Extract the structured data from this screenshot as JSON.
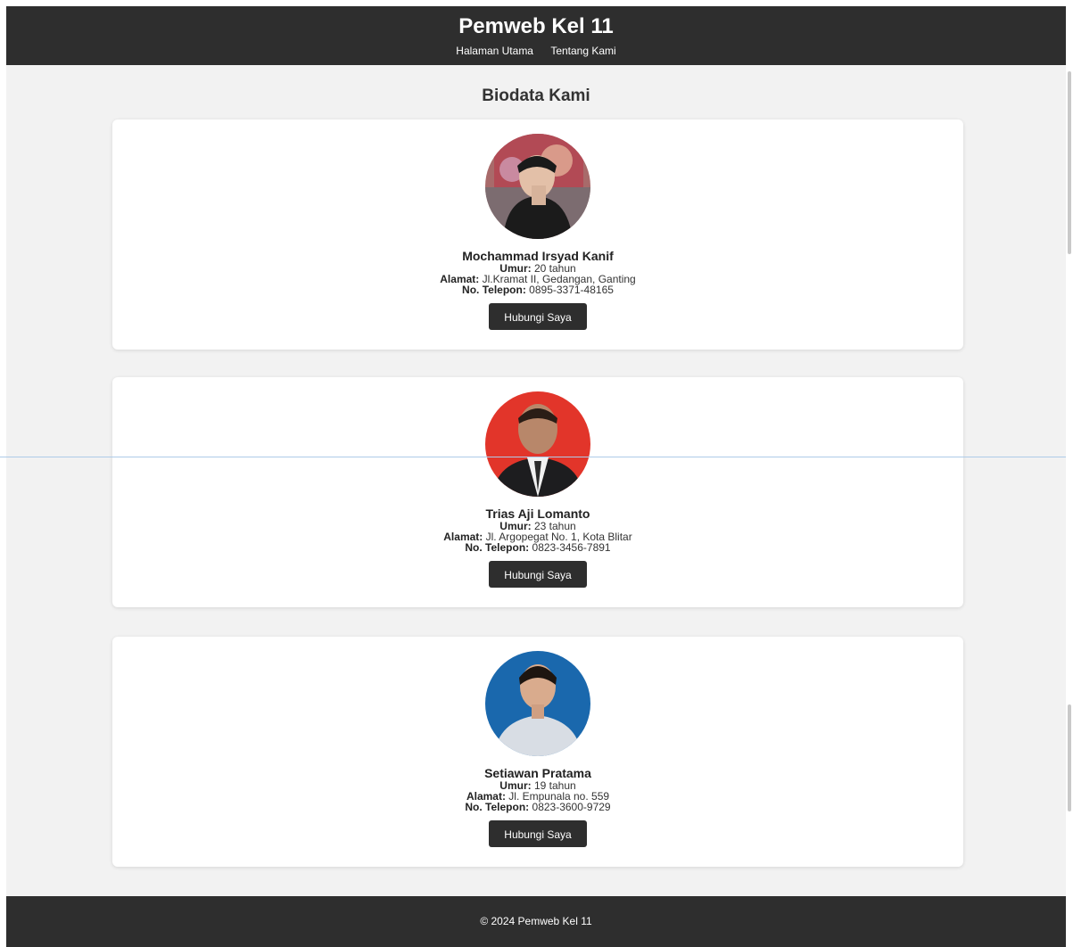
{
  "header": {
    "title": "Pemweb Kel 11",
    "nav": [
      "Halaman Utama",
      "Tentang Kami"
    ]
  },
  "section_title": "Biodata Kami",
  "labels": {
    "age": "Umur:",
    "address": "Alamat:",
    "phone": "No. Telepon:"
  },
  "members": [
    {
      "name": "Mochammad Irsyad Kanif",
      "age": "20 tahun",
      "address": "Jl.Kramat II, Gedangan, Ganting",
      "phone": "0895-3371-48165",
      "button": "Hubungi Saya"
    },
    {
      "name": "Trias Aji Lomanto",
      "age": "23 tahun",
      "address": "Jl. Argopegat No. 1, Kota Blitar",
      "phone": "0823-3456-7891",
      "button": "Hubungi Saya"
    },
    {
      "name": "Setiawan Pratama",
      "age": "19 tahun",
      "address": "Jl. Empunala no. 559",
      "phone": "0823-3600-9729",
      "button": "Hubungi Saya"
    }
  ],
  "footer": {
    "text": "© 2024 Pemweb Kel 11"
  },
  "colors": {
    "header_bg": "#2e2e2e",
    "page_bg": "#f2f2f2",
    "card_bg": "#ffffff",
    "button_bg": "#2e2e2e"
  }
}
